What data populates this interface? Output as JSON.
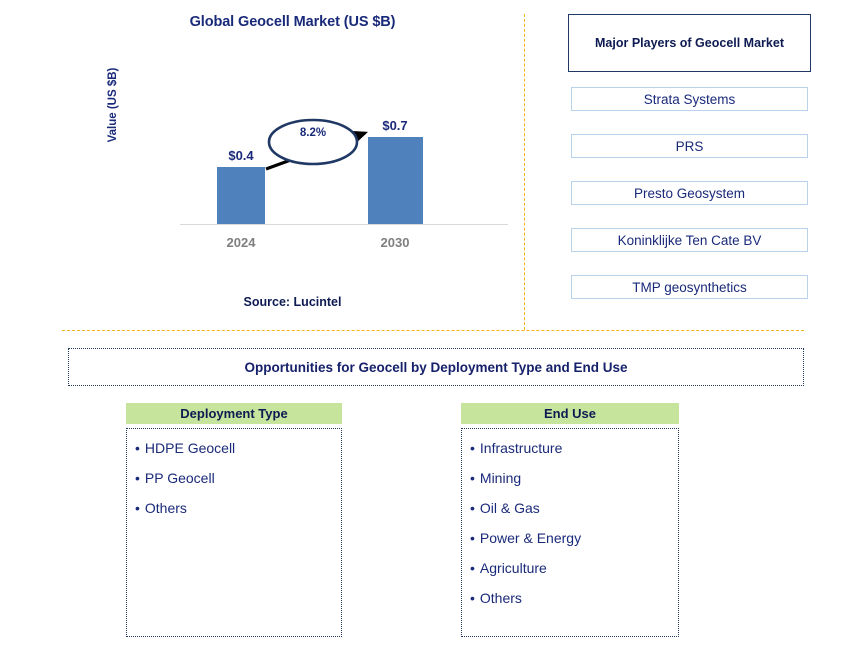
{
  "chart": {
    "title": "Global Geocell Market (US $B)",
    "source": "Source: Lucintel"
  },
  "chart_data": {
    "type": "bar",
    "title": "Global Geocell Market (US $B)",
    "xlabel": "",
    "ylabel": "Value (US $B)",
    "categories": [
      "2024",
      "2030"
    ],
    "values": [
      0.4,
      0.7
    ],
    "value_labels": [
      "$0.4",
      "$0.7"
    ],
    "ylim": [
      0,
      0.8
    ],
    "grid": false,
    "legend": null,
    "bar_color": "#4f81bd",
    "annotations": [
      {
        "type": "cagr-callout",
        "text": "8.2%",
        "from_category": "2024",
        "to_category": "2030",
        "shape": "ellipse-with-arrow"
      }
    ]
  },
  "players": {
    "header": "Major Players of Geocell Market",
    "items": [
      {
        "label": "Strata Systems"
      },
      {
        "label": "PRS"
      },
      {
        "label": "Presto Geosystem"
      },
      {
        "label": "Koninklijke Ten Cate BV"
      },
      {
        "label": "TMP geosynthetics"
      }
    ]
  },
  "opportunities": {
    "banner": "Opportunities for Geocell by Deployment Type and End Use",
    "columns": [
      {
        "header": "Deployment Type",
        "items": [
          "HDPE Geocell",
          "PP Geocell",
          "Others"
        ]
      },
      {
        "header": "End Use",
        "items": [
          "Infrastructure",
          "Mining",
          "Oil & Gas",
          "Power & Energy",
          "Agriculture",
          "Others"
        ]
      }
    ],
    "bullet": "•"
  },
  "colors": {
    "bar": "#4f81bd",
    "navy": "#16216b",
    "header_green": "#c6e49b",
    "divider_orange": "#f5b31a",
    "player_border": "#b7d2ea"
  }
}
